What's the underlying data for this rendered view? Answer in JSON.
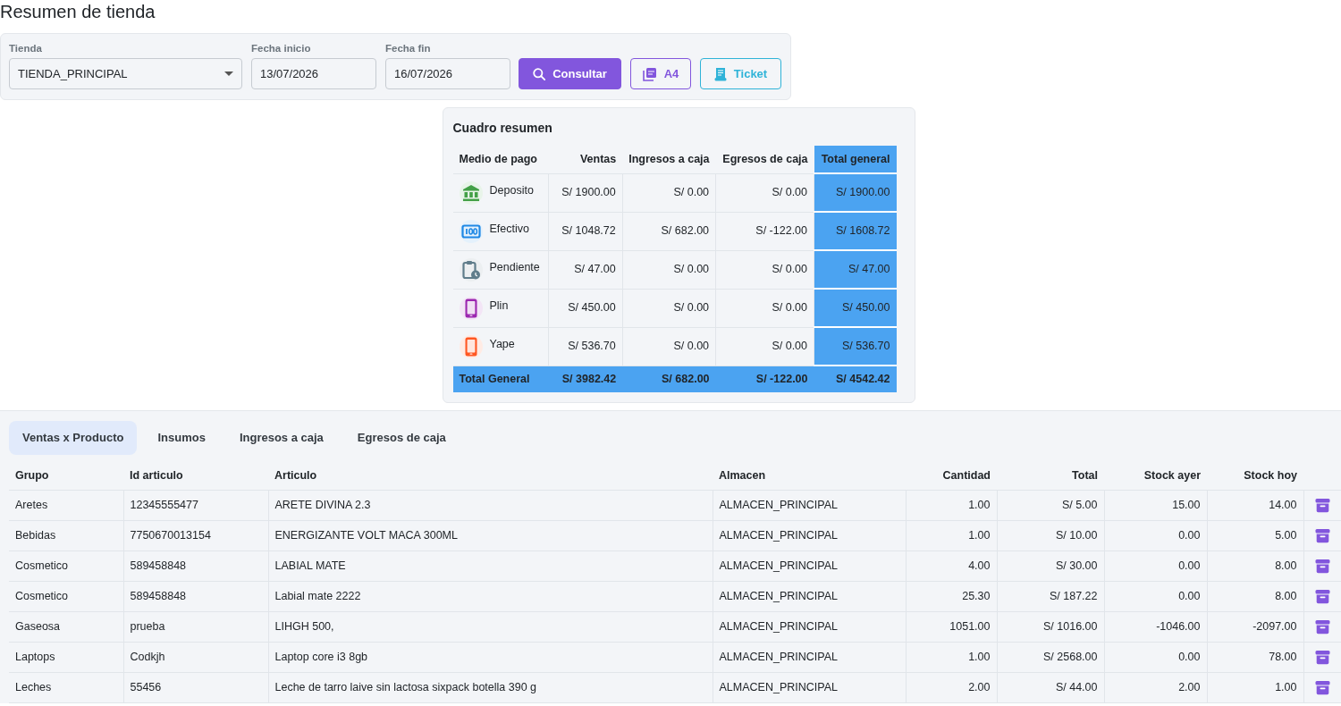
{
  "page": {
    "title": "Resumen de tienda"
  },
  "filters": {
    "store": {
      "label": "Tienda",
      "value": "TIENDA_PRINCIPAL"
    },
    "start_date": {
      "label": "Fecha inicio",
      "value": "13/07/2026"
    },
    "end_date": {
      "label": "Fecha fin",
      "value": "16/07/2026"
    },
    "buttons": [
      {
        "label": "Consultar",
        "kind": "search"
      },
      {
        "label": "A4",
        "kind": "pdf"
      },
      {
        "label": "Ticket",
        "kind": "ticket"
      }
    ]
  },
  "summary": {
    "title": "Cuadro resumen",
    "columns": [
      {
        "label": "Medio de pago",
        "highlighted": false
      },
      {
        "label": "Ventas",
        "highlighted": false
      },
      {
        "label": "Ingresos a caja",
        "highlighted": false
      },
      {
        "label": "Egresos de caja",
        "highlighted": false
      },
      {
        "label": "Total general",
        "highlighted": true
      }
    ],
    "rows": [
      {
        "method": "Deposito",
        "kind": "bank",
        "color": "#43a047",
        "values": [
          "S/ 1900.00",
          "S/ 0.00",
          "S/ 0.00",
          "S/ 1900.00"
        ]
      },
      {
        "method": "Efectivo",
        "kind": "cash",
        "color": "#1e88e5",
        "values": [
          "S/ 1048.72",
          "S/ 682.00",
          "S/ -122.00",
          "S/ 1608.72"
        ]
      },
      {
        "method": "Pendiente",
        "kind": "pending",
        "color": "#607d8b",
        "values": [
          "S/ 47.00",
          "S/ 0.00",
          "S/ 0.00",
          "S/ 47.00"
        ]
      },
      {
        "method": "Plin",
        "kind": "phone",
        "color": "#9c27b0",
        "values": [
          "S/ 450.00",
          "S/ 0.00",
          "S/ 0.00",
          "S/ 450.00"
        ]
      },
      {
        "method": "Yape",
        "kind": "phone",
        "color": "#ff5722",
        "values": [
          "S/ 536.70",
          "S/ 0.00",
          "S/ 0.00",
          "S/ 536.70"
        ]
      }
    ],
    "total_row": {
      "label": "Total General",
      "values": [
        "S/ 3982.42",
        "S/ 682.00",
        "S/ -122.00",
        "S/ 4542.42"
      ]
    }
  },
  "tabs": [
    {
      "label": "Ventas x Producto",
      "selected": true
    },
    {
      "label": "Insumos",
      "selected": false
    },
    {
      "label": "Ingresos a caja",
      "selected": false
    },
    {
      "label": "Egresos de caja",
      "selected": false
    }
  ],
  "table": {
    "columns": [
      "Grupo",
      "Id articulo",
      "Articulo",
      "Almacen",
      "Cantidad",
      "Total",
      "Stock ayer",
      "Stock hoy"
    ],
    "rows": [
      [
        "Aretes",
        "12345555477",
        "ARETE DIVINA 2.3",
        "ALMACEN_PRINCIPAL",
        "1.00",
        "S/ 5.00",
        "15.00",
        "14.00"
      ],
      [
        "Bebidas",
        "7750670013154",
        "ENERGIZANTE VOLT MACA 300ML",
        "ALMACEN_PRINCIPAL",
        "1.00",
        "S/ 10.00",
        "0.00",
        "5.00"
      ],
      [
        "Cosmetico",
        "589458848",
        "LABIAL MATE",
        "ALMACEN_PRINCIPAL",
        "4.00",
        "S/ 30.00",
        "0.00",
        "8.00"
      ],
      [
        "Cosmetico",
        "589458848",
        "Labial mate 2222",
        "ALMACEN_PRINCIPAL",
        "25.30",
        "S/ 187.22",
        "0.00",
        "8.00"
      ],
      [
        "Gaseosa",
        "prueba",
        "LIHGH 500,",
        "ALMACEN_PRINCIPAL",
        "1051.00",
        "S/ 1016.00",
        "-1046.00",
        "-2097.00"
      ],
      [
        "Laptops",
        "Codkjh",
        "Laptop core i3 8gb",
        "ALMACEN_PRINCIPAL",
        "1.00",
        "S/ 2568.00",
        "0.00",
        "78.00"
      ],
      [
        "Leches",
        "55456",
        "Leche de tarro laive sin lactosa sixpack botella 390 g",
        "ALMACEN_PRINCIPAL",
        "2.00",
        "S/ 44.00",
        "2.00",
        "1.00"
      ]
    ]
  }
}
